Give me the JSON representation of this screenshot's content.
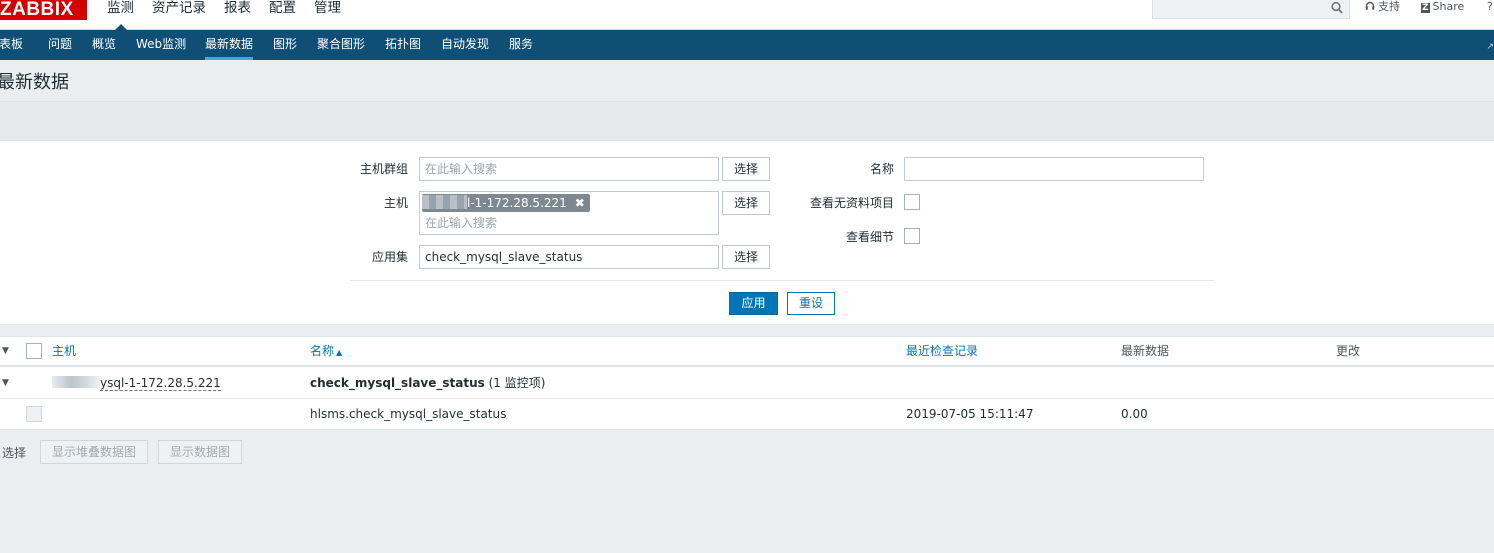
{
  "header": {
    "logo": "ZABBIX",
    "menu": [
      "监测",
      "资产记录",
      "报表",
      "配置",
      "管理"
    ],
    "search_value": "",
    "support": "支持",
    "share": "Share",
    "help": "?"
  },
  "subnav": {
    "items": [
      "仪表板",
      "问题",
      "概览",
      "Web监测",
      "最新数据",
      "图形",
      "聚合图形",
      "拓扑图",
      "自动发现",
      "服务"
    ],
    "selected": "最新数据"
  },
  "page": {
    "title": "最新数据"
  },
  "filter": {
    "host_group_label": "主机群组",
    "host_group_placeholder": "在此输入搜索",
    "host_label": "主机",
    "host_chip": "l-1-172.28.5.221",
    "host_placeholder": "在此输入搜索",
    "application_label": "应用集",
    "application_value": "check_mysql_slave_status",
    "select_label": "选择",
    "name_label": "名称",
    "name_value": "",
    "show_items_without_data_label": "查看无资料项目",
    "show_details_label": "查看细节",
    "apply_label": "应用",
    "reset_label": "重设"
  },
  "table": {
    "columns": {
      "host": "主机",
      "name": "名称",
      "last_check": "最近检查记录",
      "last_value": "最新数据",
      "change": "更改"
    },
    "group_row": {
      "host": "ysql-1-172.28.5.221",
      "application": "check_mysql_slave_status",
      "count": "(1 监控项)"
    },
    "item_row": {
      "name": "hlsms.check_mysql_slave_status",
      "last_check": "2019-07-05 15:11:47",
      "last_value": "0.00"
    }
  },
  "footer": {
    "select_label": "选择",
    "stacked_graph_label": "显示堆叠数据图",
    "graph_label": "显示数据图"
  }
}
